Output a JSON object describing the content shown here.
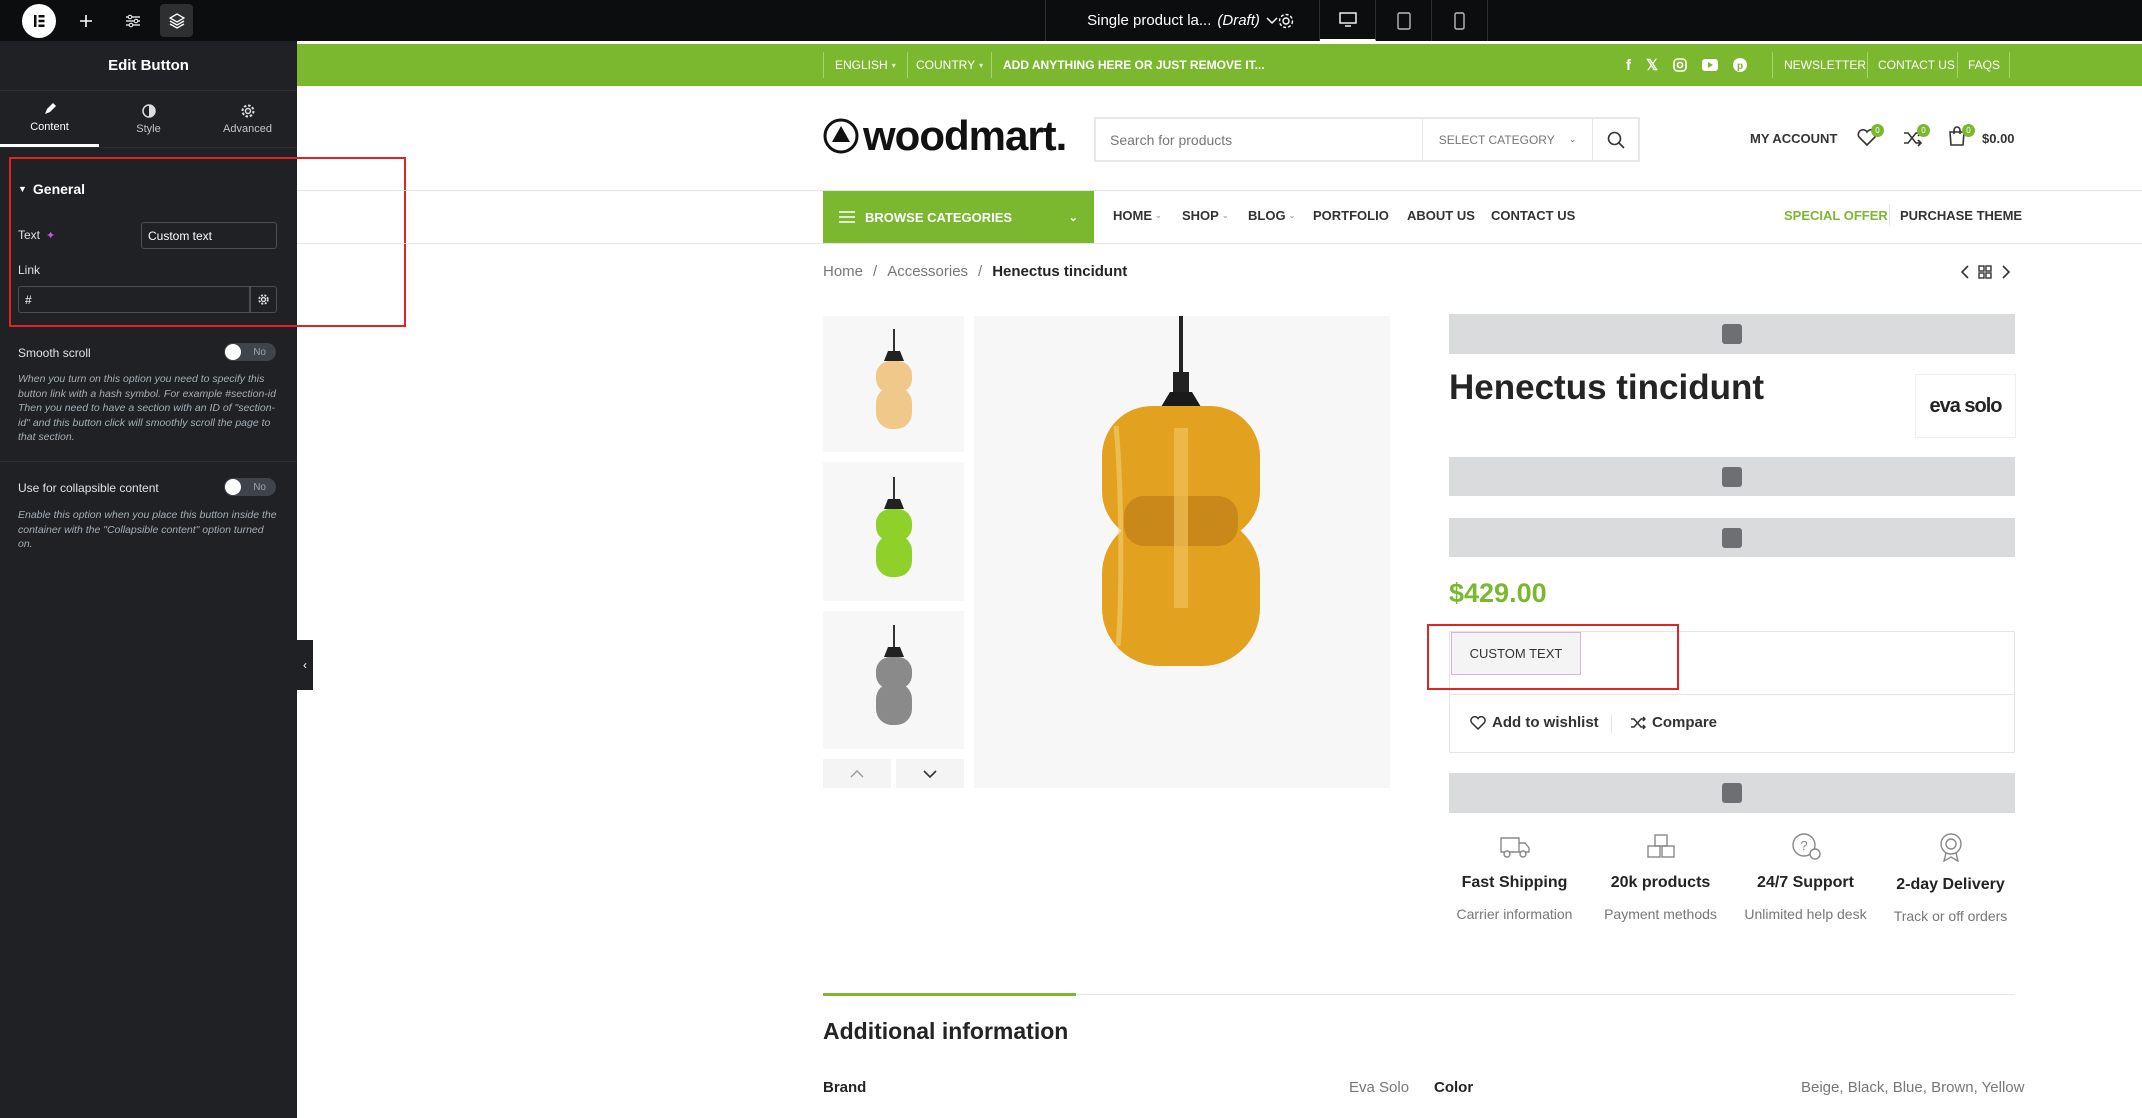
{
  "editor": {
    "doc_title": "Single product la...",
    "doc_status": "(Draft)"
  },
  "panel": {
    "title": "Edit Button",
    "tabs": [
      {
        "label": "Content"
      },
      {
        "label": "Style"
      },
      {
        "label": "Advanced"
      }
    ],
    "section": "General",
    "text_label": "Text",
    "text_value": "Custom text",
    "link_label": "Link",
    "link_value": "#",
    "smooth_label": "Smooth scroll",
    "smooth_value": "No",
    "smooth_note": "When you turn on this option you need to specify this button link with a hash symbol. For example #section-id Then you need to have a section with an ID of \"section-id\" and this button click will smoothly scroll the page to that section.",
    "collapsible_label": "Use for collapsible content",
    "collapsible_value": "No",
    "collapsible_note": "Enable this option when you place this button inside the container with the \"Collapsible content\" option turned on."
  },
  "topbar": {
    "language": "ENGLISH",
    "country": "COUNTRY",
    "promo": "ADD ANYTHING HERE OR JUST REMOVE IT...",
    "links": [
      "NEWSLETTER",
      "CONTACT US",
      "FAQS"
    ]
  },
  "header": {
    "logo": "woodmart.",
    "search_placeholder": "Search for products",
    "category": "SELECT CATEGORY",
    "account": "MY ACCOUNT",
    "wishlist_count": "0",
    "compare_count": "0",
    "cart_count": "0",
    "cart_total": "$0.00"
  },
  "nav": {
    "browse": "BROWSE CATEGORIES",
    "items": [
      "HOME",
      "SHOP",
      "BLOG",
      "PORTFOLIO",
      "ABOUT US",
      "CONTACT US"
    ],
    "special": "SPECIAL OFFER",
    "purchase": "PURCHASE THEME"
  },
  "breadcrumb": [
    "Home",
    "/",
    "Accessories",
    "/",
    "Henectus tincidunt"
  ],
  "product": {
    "title": "Henectus tincidunt",
    "brand": "eva solo",
    "price": "$429.00",
    "button": "CUSTOM TEXT",
    "wishlist": "Add to wishlist",
    "compare": "Compare"
  },
  "features": [
    {
      "title": "Fast Shipping",
      "sub": "Carrier information"
    },
    {
      "title": "20k products",
      "sub": "Payment methods"
    },
    {
      "title": "24/7 Support",
      "sub": "Unlimited help desk"
    },
    {
      "title": "2-day Delivery",
      "sub": "Track or off orders"
    }
  ],
  "additional": {
    "title": "Additional information",
    "brand_label": "Brand",
    "brand_value": "Eva Solo",
    "color_label": "Color",
    "color_value": "Beige, Black, Blue, Brown, Yellow"
  },
  "colors": {
    "accent": "#7cb82f",
    "panel": "#1f2124",
    "highlight": "#e02424",
    "amber": "#e2a21f",
    "lime": "#8fd12a",
    "smoke": "#8a8a8a"
  }
}
